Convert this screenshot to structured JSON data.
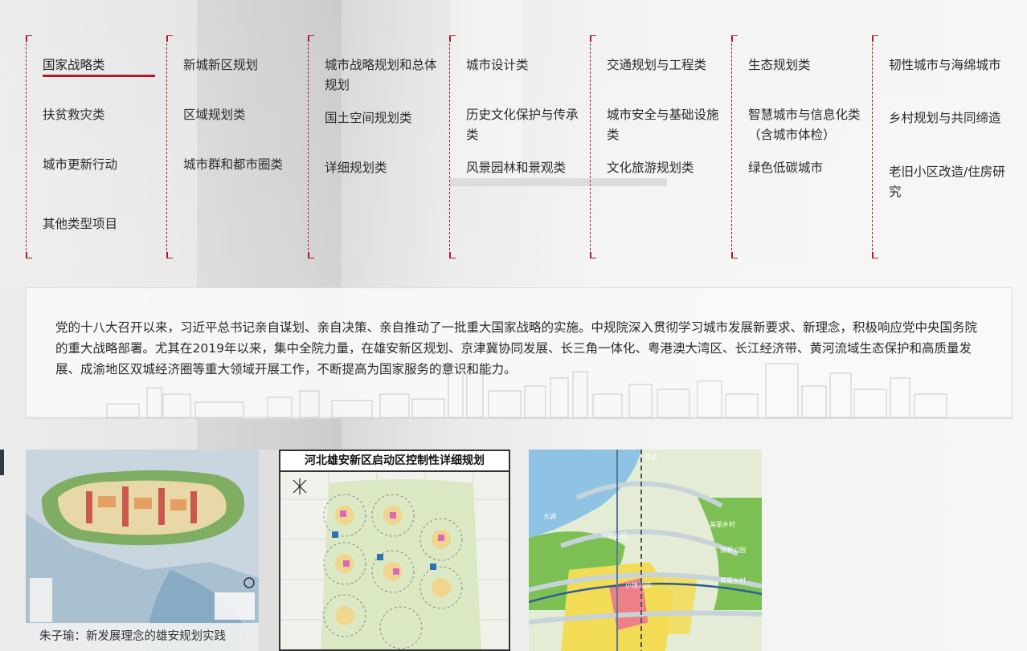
{
  "categories": {
    "columns": [
      [
        "国家战略类",
        "扶贫救灾类",
        "城市更新行动",
        "其他类型项目"
      ],
      [
        "新城新区规划",
        "区域规划类",
        "城市群和都市圈类"
      ],
      [
        "城市战略规划和总体规划",
        "国土空间规划类",
        "详细规划类"
      ],
      [
        "城市设计类",
        "历史文化保护与传承类",
        "风景园林和景观类"
      ],
      [
        "交通规划与工程类",
        "城市安全与基础设施类",
        "文化旅游规划类"
      ],
      [
        "生态规划类",
        "智慧城市与信息化类（含城市体检）",
        "绿色低碳城市"
      ],
      [
        "韧性城市与海绵城市",
        "乡村规划与共同缔造",
        "老旧小区改造/住房研究"
      ]
    ],
    "active": "国家战略类",
    "accent_color": "#b01c24"
  },
  "intro": {
    "text": "党的十八大召开以来，习近平总书记亲自谋划、亲自决策、亲自推动了一批重大国家战略的实施。中规院深入贯彻学习城市发展新要求、新理念，积极响应党中央国务院的重大战略部署。尤其在2019年以来，集中全院力量，在雄安新区规划、京津冀协同发展、长三角一体化、粤港澳大湾区、长江经济带、黄河流域生态保护和高质量发展、成渝地区双城经济圈等重大领域开展工作，不断提高为国家服务的意识和能力。"
  },
  "cards": [
    {
      "caption": "朱子瑜：新发展理念的雄安规划实践",
      "image": "xiongan-master-plan-map"
    },
    {
      "title": "河北雄安新区启动区控制性详细规划",
      "image": "startup-area-regulatory-plan-map"
    },
    {
      "image": "xiongan-transport-district-map",
      "labels": [
        "大湖",
        "郊野公园",
        "美丽乡村",
        "郊野公园",
        "美丽乡村",
        "小镇公园",
        "轨道"
      ]
    }
  ]
}
